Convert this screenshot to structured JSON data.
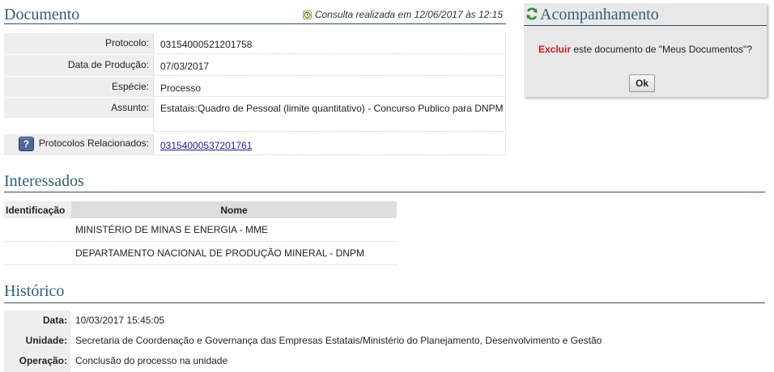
{
  "documento": {
    "title": "Documento",
    "consulta": "Consulta realizada em 12/06/2017 às 12:15",
    "rows": [
      {
        "label": "Protocolo:",
        "value": "03154000521201758"
      },
      {
        "label": "Data de Produção:",
        "value": "07/03/2017"
      },
      {
        "label": "Espécie:",
        "value": "Processo"
      },
      {
        "label": "Assunto:",
        "value": "Estatais:Quadro de Pessoal (limite quantitativo) - Concurso Publico para DNPM"
      }
    ],
    "relacionados": {
      "label": "Protocolos Relacionados:",
      "value": "03154000537201761",
      "help": "?"
    }
  },
  "acompanhamento": {
    "title": "Acompanhamento",
    "excluir": "Excluir",
    "msg_rest": " este documento de \"Meus Documentos\"?",
    "ok": "Ok"
  },
  "interessados": {
    "title": "Interessados",
    "headers": [
      "Identificação",
      "Nome"
    ],
    "rows": [
      {
        "id": "",
        "nome": "MINISTÉRIO DE MINAS E ENERGIA - MME"
      },
      {
        "id": "",
        "nome": "DEPARTAMENTO NACIONAL DE PRODUÇÃO MINERAL - DNPM"
      }
    ]
  },
  "historico": {
    "title": "Histórico",
    "rows": [
      {
        "label": "Data:",
        "value": "10/03/2017 15:45:05"
      },
      {
        "label": "Unidade:",
        "value": "Secretaria de Coordenação e Governança das Empresas Estatais/Ministério do Planejamento, Desenvolvimento e Gestão"
      },
      {
        "label": "Operação:",
        "value": "Conclusão do processo na unidade"
      }
    ]
  },
  "colors": {
    "header_text": "#2f5f7d",
    "header_rule": "#2f4f66",
    "excluir": "#c81e1e",
    "link": "#1a1aa6"
  },
  "icons": {
    "consulta": "clock-icon",
    "acompanhamento": "refresh-icon",
    "relacionados": "help-icon"
  }
}
